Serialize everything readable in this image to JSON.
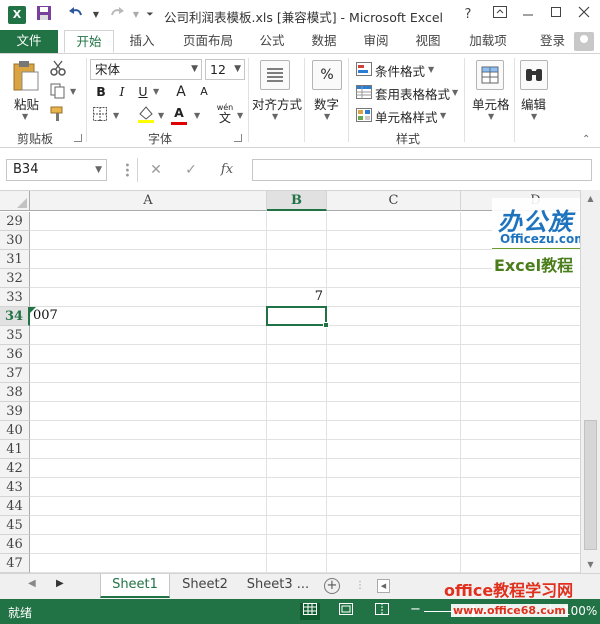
{
  "app": {
    "logo": "X",
    "title": "公司利润表模板.xls  [兼容模式] - Microsoft Excel",
    "help": "?"
  },
  "tabs": {
    "file": "文件",
    "items": [
      "开始",
      "插入",
      "页面布局",
      "公式",
      "数据",
      "审阅",
      "视图",
      "加载项"
    ],
    "active": "开始",
    "login": "登录"
  },
  "ribbon": {
    "clipboard": {
      "paste_label": "粘贴",
      "group_label": "剪贴板"
    },
    "font": {
      "font_name": "宋体",
      "font_size": "12",
      "bold": "B",
      "italic": "I",
      "underline": "U",
      "grow": "A",
      "shrink": "A",
      "color_letter": "A",
      "wen_label": "wén",
      "wen_char": "文",
      "group_label": "字体"
    },
    "alignment": {
      "label": "对齐方式"
    },
    "number": {
      "icon": "%",
      "label": "数字"
    },
    "styles": {
      "conditional": "条件格式",
      "table": "套用表格格式",
      "cell": "单元格样式",
      "group_label": "样式"
    },
    "cells": {
      "label": "单元格"
    },
    "editing": {
      "label": "编辑"
    }
  },
  "formula_bar": {
    "name_box": "B34",
    "cancel": "✕",
    "enter": "✓",
    "fx": "fx",
    "formula": ""
  },
  "grid": {
    "columns": [
      "A",
      "B",
      "C",
      "D"
    ],
    "selected_column": "B",
    "rows": [
      "29",
      "30",
      "31",
      "32",
      "33",
      "34",
      "35",
      "36",
      "37",
      "38",
      "39",
      "40",
      "41",
      "42",
      "43",
      "44",
      "45",
      "46",
      "47"
    ],
    "selected_row": "34",
    "cells": {
      "B33": "7",
      "A34": "007"
    },
    "colors": {
      "accent": "#217346",
      "header_bg": "#f3f3f3",
      "gridline": "#e1e1e1"
    }
  },
  "watermark": {
    "brand": "办公族",
    "domain": "Officezu.com",
    "tagline": "Excel教程",
    "bottom_text": "office教程学习网",
    "bottom_url": "www.office68.com"
  },
  "sheets": {
    "tabs": [
      "Sheet1",
      "Sheet2",
      "Sheet3 ..."
    ],
    "active": "Sheet1",
    "add": "+"
  },
  "status": {
    "ready": "就绪",
    "zoom_minus": "−",
    "zoom_plus": "+",
    "zoom": "100%"
  }
}
